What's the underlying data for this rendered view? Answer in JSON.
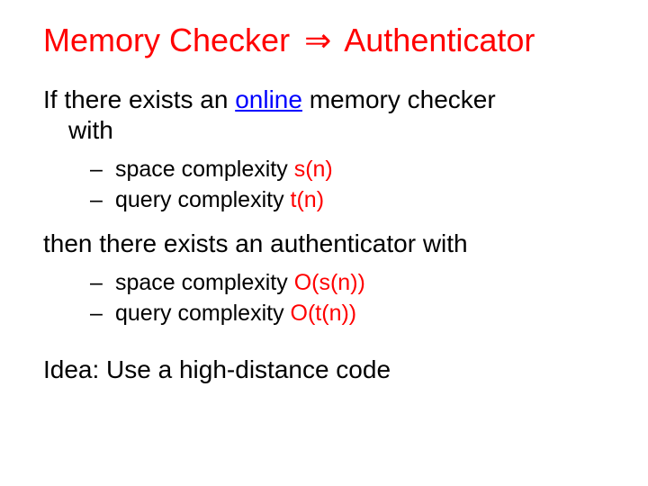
{
  "title": {
    "left": "Memory Checker",
    "arrow": "⇒",
    "right": "Authenticator"
  },
  "para1": {
    "l1a": "If there exists an ",
    "online": "online",
    "l1b": " memory checker",
    "l2": "with"
  },
  "sub1": {
    "dash": "–",
    "r1a": "space complexity ",
    "r1b": "s(n)",
    "r2a": "query complexity ",
    "r2b": "t(n)"
  },
  "para2": {
    "l1": "then there exists an authenticator with"
  },
  "sub2": {
    "dash": "–",
    "r1a": "space complexity ",
    "r1b": "O(s(n))",
    "r2a": "query complexity ",
    "r2b": "O(t(n))"
  },
  "idea": "Idea: Use a high-distance code"
}
